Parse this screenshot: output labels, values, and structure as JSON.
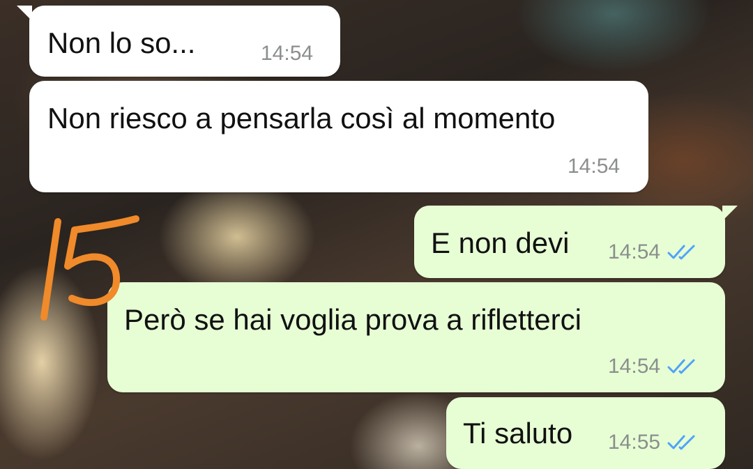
{
  "messages": [
    {
      "text": "Non lo so...",
      "time": "14:54",
      "direction": "incoming"
    },
    {
      "text": "Non riesco a pensarla così al momento",
      "time": "14:54",
      "direction": "incoming"
    },
    {
      "text": "E non devi",
      "time": "14:54",
      "direction": "outgoing",
      "status_icon": "double-check-icon"
    },
    {
      "text": "Però se hai voglia prova a rifletterci",
      "time": "14:54",
      "direction": "outgoing",
      "status_icon": "double-check-icon"
    },
    {
      "text": "Ti saluto",
      "time": "14:55",
      "direction": "outgoing",
      "status_icon": "double-check-icon"
    }
  ],
  "annotation": {
    "label": "15",
    "color": "#f08a2a"
  },
  "colors": {
    "incoming_bubble": "#ffffff",
    "outgoing_bubble": "#e7fed5",
    "read_ticks": "#4fa3f7",
    "timestamp": "#8a8f8c"
  }
}
